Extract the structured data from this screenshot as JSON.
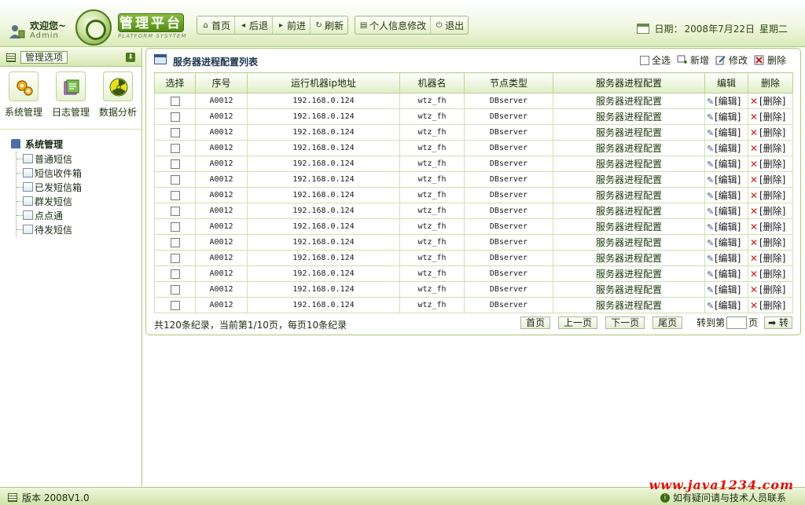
{
  "header": {
    "welcome": "欢迎您~",
    "user": "Admin",
    "app_title": "管理平台",
    "app_subtitle": "PLATFORM SYSYTEM",
    "nav": [
      {
        "label": "首页",
        "icon": "home-icon",
        "glyph": "⌂"
      },
      {
        "label": "后退",
        "icon": "back-icon",
        "glyph": "◂"
      },
      {
        "label": "前进",
        "icon": "forward-icon",
        "glyph": "▸"
      },
      {
        "label": "刷新",
        "icon": "refresh-icon",
        "glyph": "↻"
      }
    ],
    "nav2": [
      {
        "label": "个人信息修改",
        "icon": "profile-edit-icon",
        "glyph": "▤"
      },
      {
        "label": "退出",
        "icon": "logout-icon",
        "glyph": "⏻"
      }
    ],
    "date_label": "日期：",
    "date_value": "2008年7月22日",
    "weekday": "星期二"
  },
  "sidebar": {
    "title": "管理选项",
    "modules": [
      {
        "label": "系统管理",
        "icon": "gears-icon"
      },
      {
        "label": "日志管理",
        "icon": "log-book-icon"
      },
      {
        "label": "数据分析",
        "icon": "radiation-icon"
      }
    ],
    "tree_root": "系统管理",
    "tree_items": [
      "普通短信",
      "短信收件箱",
      "已发短信箱",
      "群发短信",
      "点点通",
      "待发短信"
    ]
  },
  "main": {
    "title": "服务器进程配置列表",
    "actions": {
      "select_all": "全选",
      "add": "新增",
      "modify": "修改",
      "delete": "删除"
    },
    "columns": [
      "选择",
      "序号",
      "运行机器ip地址",
      "机器名",
      "节点类型",
      "服务器进程配置",
      "编辑",
      "删除"
    ],
    "rows": [
      {
        "id": "A0012",
        "ip": "192.168.0.124",
        "machine": "wtz_fh",
        "node": "DBserver",
        "config": "服务器进程配置",
        "edit": "[编辑]",
        "del": "[删除]"
      },
      {
        "id": "A0012",
        "ip": "192.168.0.124",
        "machine": "wtz_fh",
        "node": "DBserver",
        "config": "服务器进程配置",
        "edit": "[编辑]",
        "del": "[删除]"
      },
      {
        "id": "A0012",
        "ip": "192.168.0.124",
        "machine": "wtz_fh",
        "node": "DBserver",
        "config": "服务器进程配置",
        "edit": "[编辑]",
        "del": "[删除]"
      },
      {
        "id": "A0012",
        "ip": "192.168.0.124",
        "machine": "wtz_fh",
        "node": "DBserver",
        "config": "服务器进程配置",
        "edit": "[编辑]",
        "del": "[删除]"
      },
      {
        "id": "A0012",
        "ip": "192.168.0.124",
        "machine": "wtz_fh",
        "node": "DBserver",
        "config": "服务器进程配置",
        "edit": "[编辑]",
        "del": "[删除]"
      },
      {
        "id": "A0012",
        "ip": "192.168.0.124",
        "machine": "wtz_fh",
        "node": "DBserver",
        "config": "服务器进程配置",
        "edit": "[编辑]",
        "del": "[删除]"
      },
      {
        "id": "A0012",
        "ip": "192.168.0.124",
        "machine": "wtz_fh",
        "node": "DBserver",
        "config": "服务器进程配置",
        "edit": "[编辑]",
        "del": "[删除]"
      },
      {
        "id": "A0012",
        "ip": "192.168.0.124",
        "machine": "wtz_fh",
        "node": "DBserver",
        "config": "服务器进程配置",
        "edit": "[编辑]",
        "del": "[删除]"
      },
      {
        "id": "A0012",
        "ip": "192.168.0.124",
        "machine": "wtz_fh",
        "node": "DBserver",
        "config": "服务器进程配置",
        "edit": "[编辑]",
        "del": "[删除]"
      },
      {
        "id": "A0012",
        "ip": "192.168.0.124",
        "machine": "wtz_fh",
        "node": "DBserver",
        "config": "服务器进程配置",
        "edit": "[编辑]",
        "del": "[删除]"
      },
      {
        "id": "A0012",
        "ip": "192.168.0.124",
        "machine": "wtz_fh",
        "node": "DBserver",
        "config": "服务器进程配置",
        "edit": "[编辑]",
        "del": "[删除]"
      },
      {
        "id": "A0012",
        "ip": "192.168.0.124",
        "machine": "wtz_fh",
        "node": "DBserver",
        "config": "服务器进程配置",
        "edit": "[编辑]",
        "del": "[删除]"
      },
      {
        "id": "A0012",
        "ip": "192.168.0.124",
        "machine": "wtz_fh",
        "node": "DBserver",
        "config": "服务器进程配置",
        "edit": "[编辑]",
        "del": "[删除]"
      },
      {
        "id": "A0012",
        "ip": "192.168.0.124",
        "machine": "wtz_fh",
        "node": "DBserver",
        "config": "服务器进程配置",
        "edit": "[编辑]",
        "del": "[删除]"
      }
    ],
    "pager": {
      "info": "共120条纪录，当前第1/10页，每页10条纪录",
      "first": "首页",
      "prev": "上一页",
      "next": "下一页",
      "last": "尾页",
      "goto_prefix": "转到第",
      "goto_suffix": "页",
      "go": "➡ 转"
    }
  },
  "footer": {
    "version": "版本 2008V1.0",
    "help": "如有疑问请与技术人员联系",
    "watermark": "www.java1234.com"
  },
  "colors": {
    "accent_green": "#4f8a14",
    "header_bg": "#d9eab6",
    "border": "#a9c97a",
    "delete_red": "#c41a1a",
    "watermark_red": "#e01010"
  }
}
